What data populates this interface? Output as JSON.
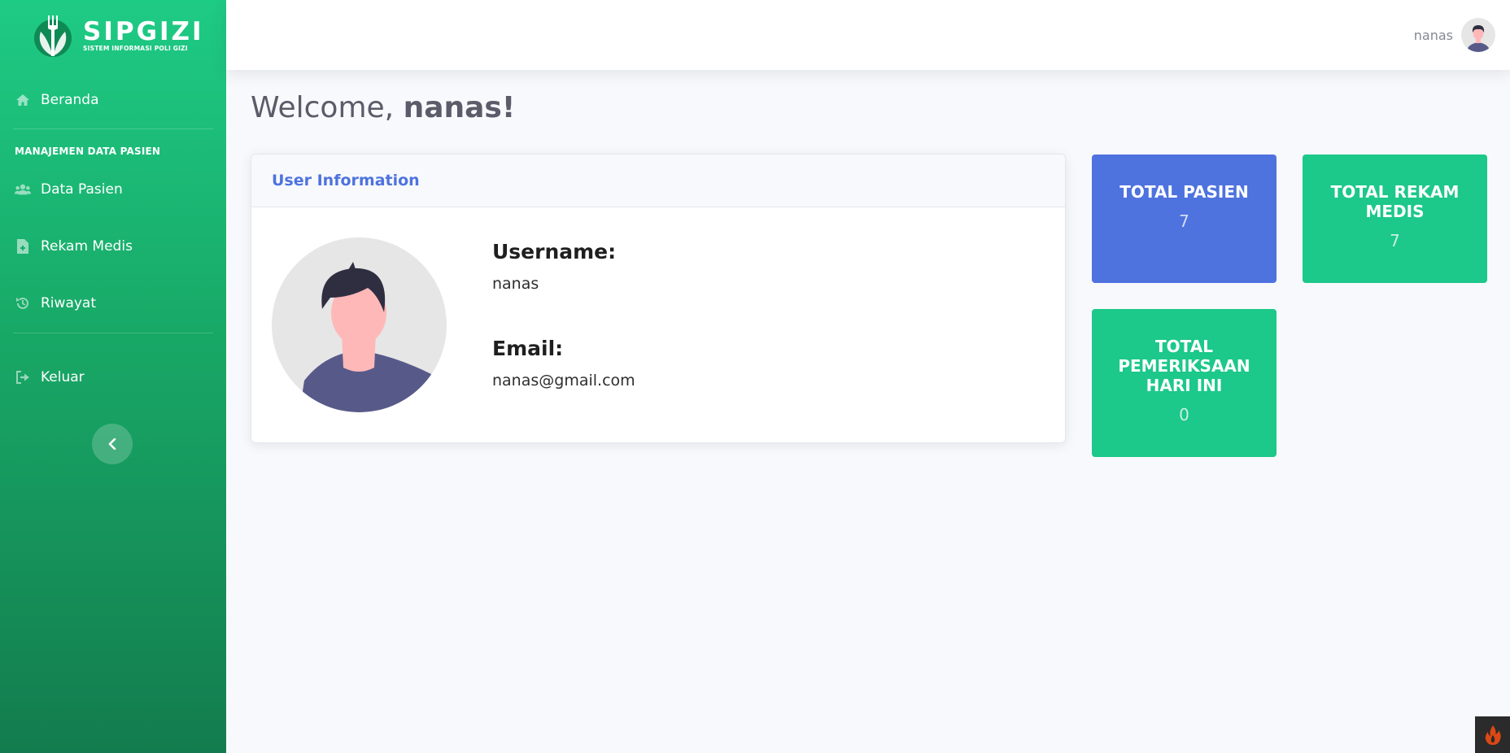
{
  "brand": {
    "title": "SIPGIZI",
    "subtitle": "SISTEM INFORMASI POLI GIZI"
  },
  "sidebar": {
    "items": [
      {
        "label": "Beranda",
        "icon": "home-icon"
      },
      {
        "label": "Data Pasien",
        "icon": "users-icon"
      },
      {
        "label": "Rekam Medis",
        "icon": "file-medical-icon"
      },
      {
        "label": "Riwayat",
        "icon": "history-icon"
      },
      {
        "label": "Keluar",
        "icon": "sign-out-icon"
      }
    ],
    "section_heading": "MANAJEMEN DATA PASIEN",
    "toggle_icon": "chevron-left-icon"
  },
  "topbar": {
    "username": "nanas"
  },
  "welcome": {
    "prefix": "Welcome, ",
    "name": "nanas!"
  },
  "user_card": {
    "title": "User Information",
    "username_label": "Username:",
    "username_value": "nanas",
    "email_label": "Email:",
    "email_value": "nanas@gmail.com"
  },
  "stats": [
    {
      "title": "TOTAL PASIEN",
      "value": "7",
      "color": "#4e73df"
    },
    {
      "title": "TOTAL REKAM MEDIS",
      "value": "7",
      "color": "#1cc88a"
    },
    {
      "title": "TOTAL PEMERIKSAAN HARI INI",
      "value": "0",
      "color": "#1cc88a"
    }
  ],
  "colors": {
    "primary": "#4e73df",
    "success": "#1cc88a",
    "sidebar_top": "#1ecb85",
    "sidebar_bottom": "#137c4e"
  }
}
